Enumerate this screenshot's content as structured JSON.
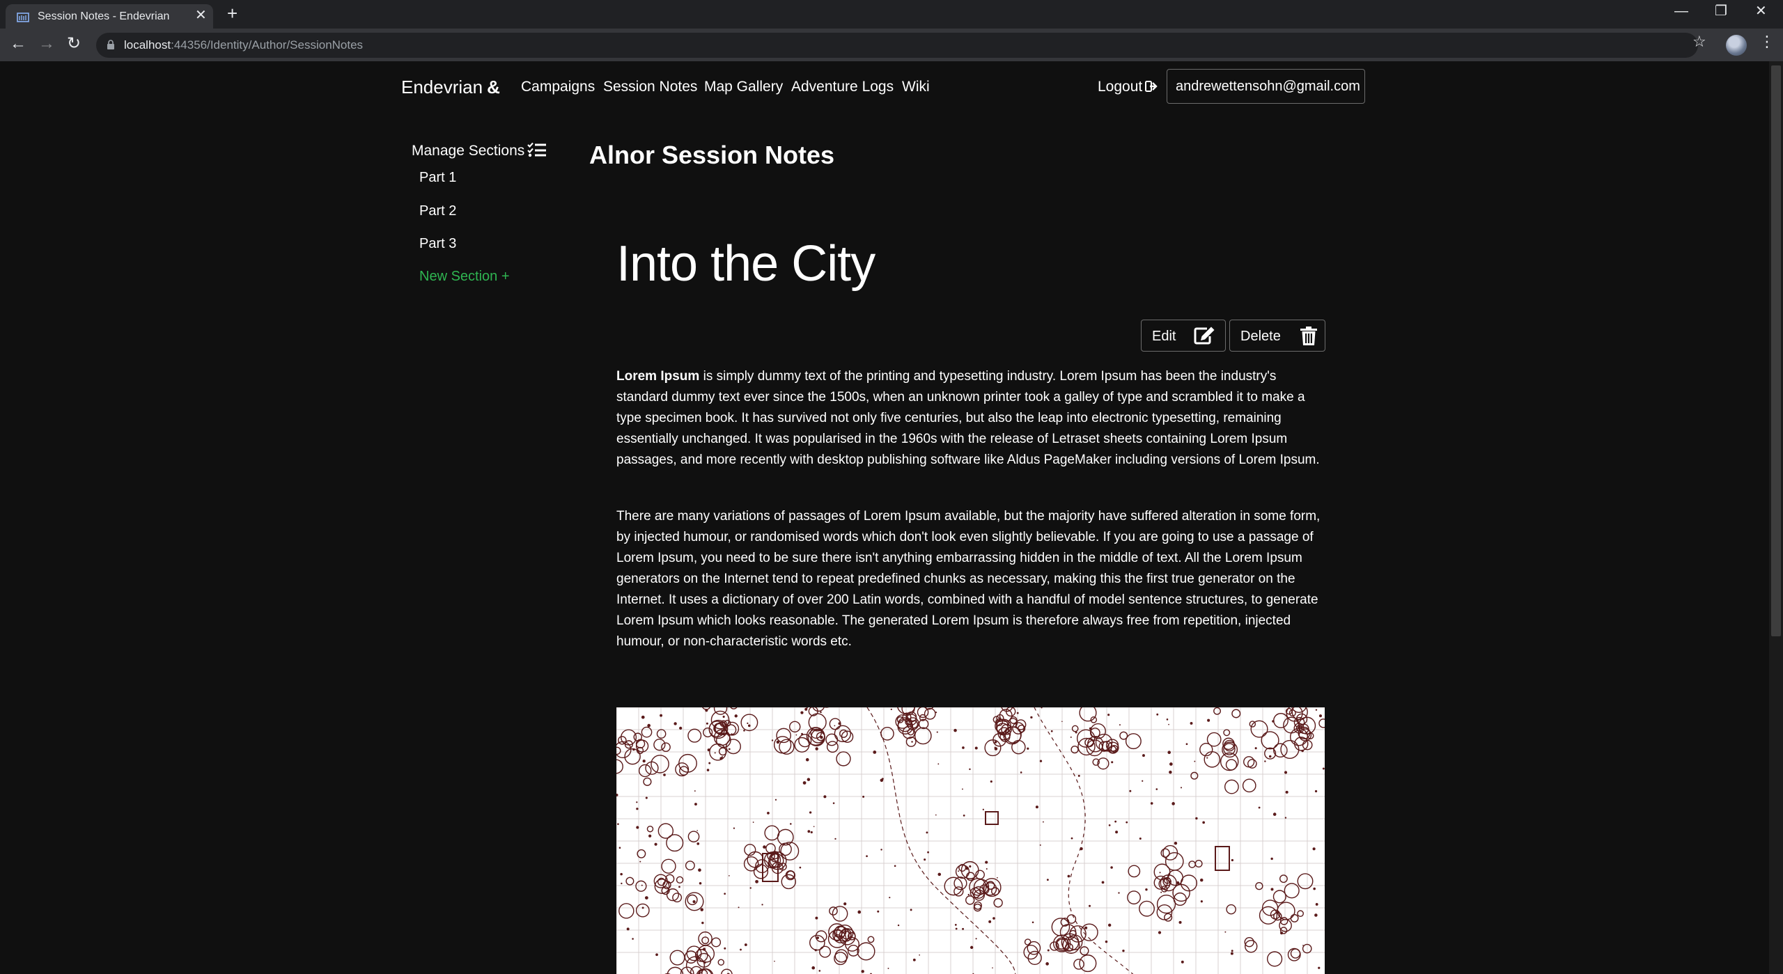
{
  "browser": {
    "tab_title": "Session Notes - Endevrian",
    "url_host": "localhost",
    "url_rest": ":44356/Identity/Author/SessionNotes"
  },
  "icons": {
    "tab_close": "✕",
    "new_tab": "+",
    "minimize": "—",
    "restore": "❐",
    "window_close": "✕",
    "back": "←",
    "forward": "→",
    "reload": "↻",
    "star": "☆",
    "menu": "⋮"
  },
  "nav": {
    "brand": "Endevrian",
    "brand_mark": "&",
    "links": [
      "Campaigns",
      "Session Notes",
      "Map Gallery",
      "Adventure Logs",
      "Wiki"
    ],
    "logout": "Logout",
    "email": "andrewettensohn@gmail.com"
  },
  "sidebar": {
    "heading": "Manage Sections",
    "items": [
      "Part 1",
      "Part 2",
      "Part 3"
    ],
    "new_section": "New Section +"
  },
  "main": {
    "page_title": "Alnor Session Notes",
    "section_title": "Into the City",
    "edit_label": "Edit",
    "delete_label": "Delete",
    "p1_bold": "Lorem Ipsum",
    "p1_rest": " is simply dummy text of the printing and typesetting industry. Lorem Ipsum has been the industry's standard dummy text ever since the 1500s, when an unknown printer took a galley of type and scrambled it to make a type specimen book. It has survived not only five centuries, but also the leap into electronic typesetting, remaining essentially unchanged. It was popularised in the 1960s with the release of Letraset sheets containing Lorem Ipsum passages, and more recently with desktop publishing software like Aldus PageMaker including versions of Lorem Ipsum.",
    "p2": "There are many variations of passages of Lorem Ipsum available, but the majority have suffered alteration in some form, by injected humour, or randomised words which don't look even slightly believable. If you are going to use a passage of Lorem Ipsum, you need to be sure there isn't anything embarrassing hidden in the middle of text. All the Lorem Ipsum generators on the Internet tend to repeat predefined chunks as necessary, making this the first true generator on the Internet. It uses a dictionary of over 200 Latin words, combined with a handful of model sentence structures, to generate Lorem Ipsum which looks reasonable. The generated Lorem Ipsum is therefore always free from repetition, injected humour, or non-characteristic words etc."
  },
  "colors": {
    "background": "#101010",
    "accent_green": "#2fb551",
    "map_ink": "#5a1a1a"
  }
}
